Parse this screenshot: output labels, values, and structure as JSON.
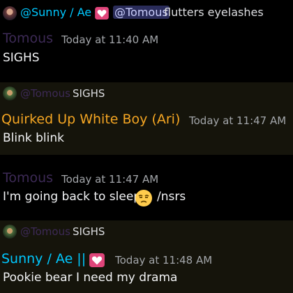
{
  "top_reply": {
    "author": "@Sunny / Ae ||",
    "mention": "@Tomous",
    "text": "flutters eyelashes"
  },
  "messages": [
    {
      "author": "Tomous",
      "time": "Today at 11:40 AM",
      "text": "SIGHS",
      "author_color": "#3d2a56"
    },
    {
      "reply_author": "@Tomous",
      "reply_text": "SIGHS",
      "author": "Quirked Up White Boy (Ari)",
      "time": "Today at 11:47 AM",
      "text": "Blink blink",
      "author_color": "#f5a623"
    },
    {
      "author": "Tomous",
      "time": "Today at 11:47 AM",
      "text_before": "I'm going back to sleep",
      "text_after": "/nsrs",
      "emoji": "unamused-face",
      "author_color": "#3d2a56"
    },
    {
      "reply_author": "@Tomous",
      "reply_text": "SIGHS",
      "author": "Sunny / Ae ||",
      "time": "Today at 11:48 AM",
      "text": "Pookie bear I need my drama",
      "author_color": "#00c8ff"
    }
  ],
  "colors": {
    "background": "#000000",
    "highlight": "#15140b",
    "mention_bg": "#2a2c5a",
    "mention_fg": "#c9cdfb",
    "heart": "#e0457b"
  },
  "icons": [
    "pink-heart-icon",
    "unamused-face-emoji",
    "reply-spine-icon"
  ]
}
